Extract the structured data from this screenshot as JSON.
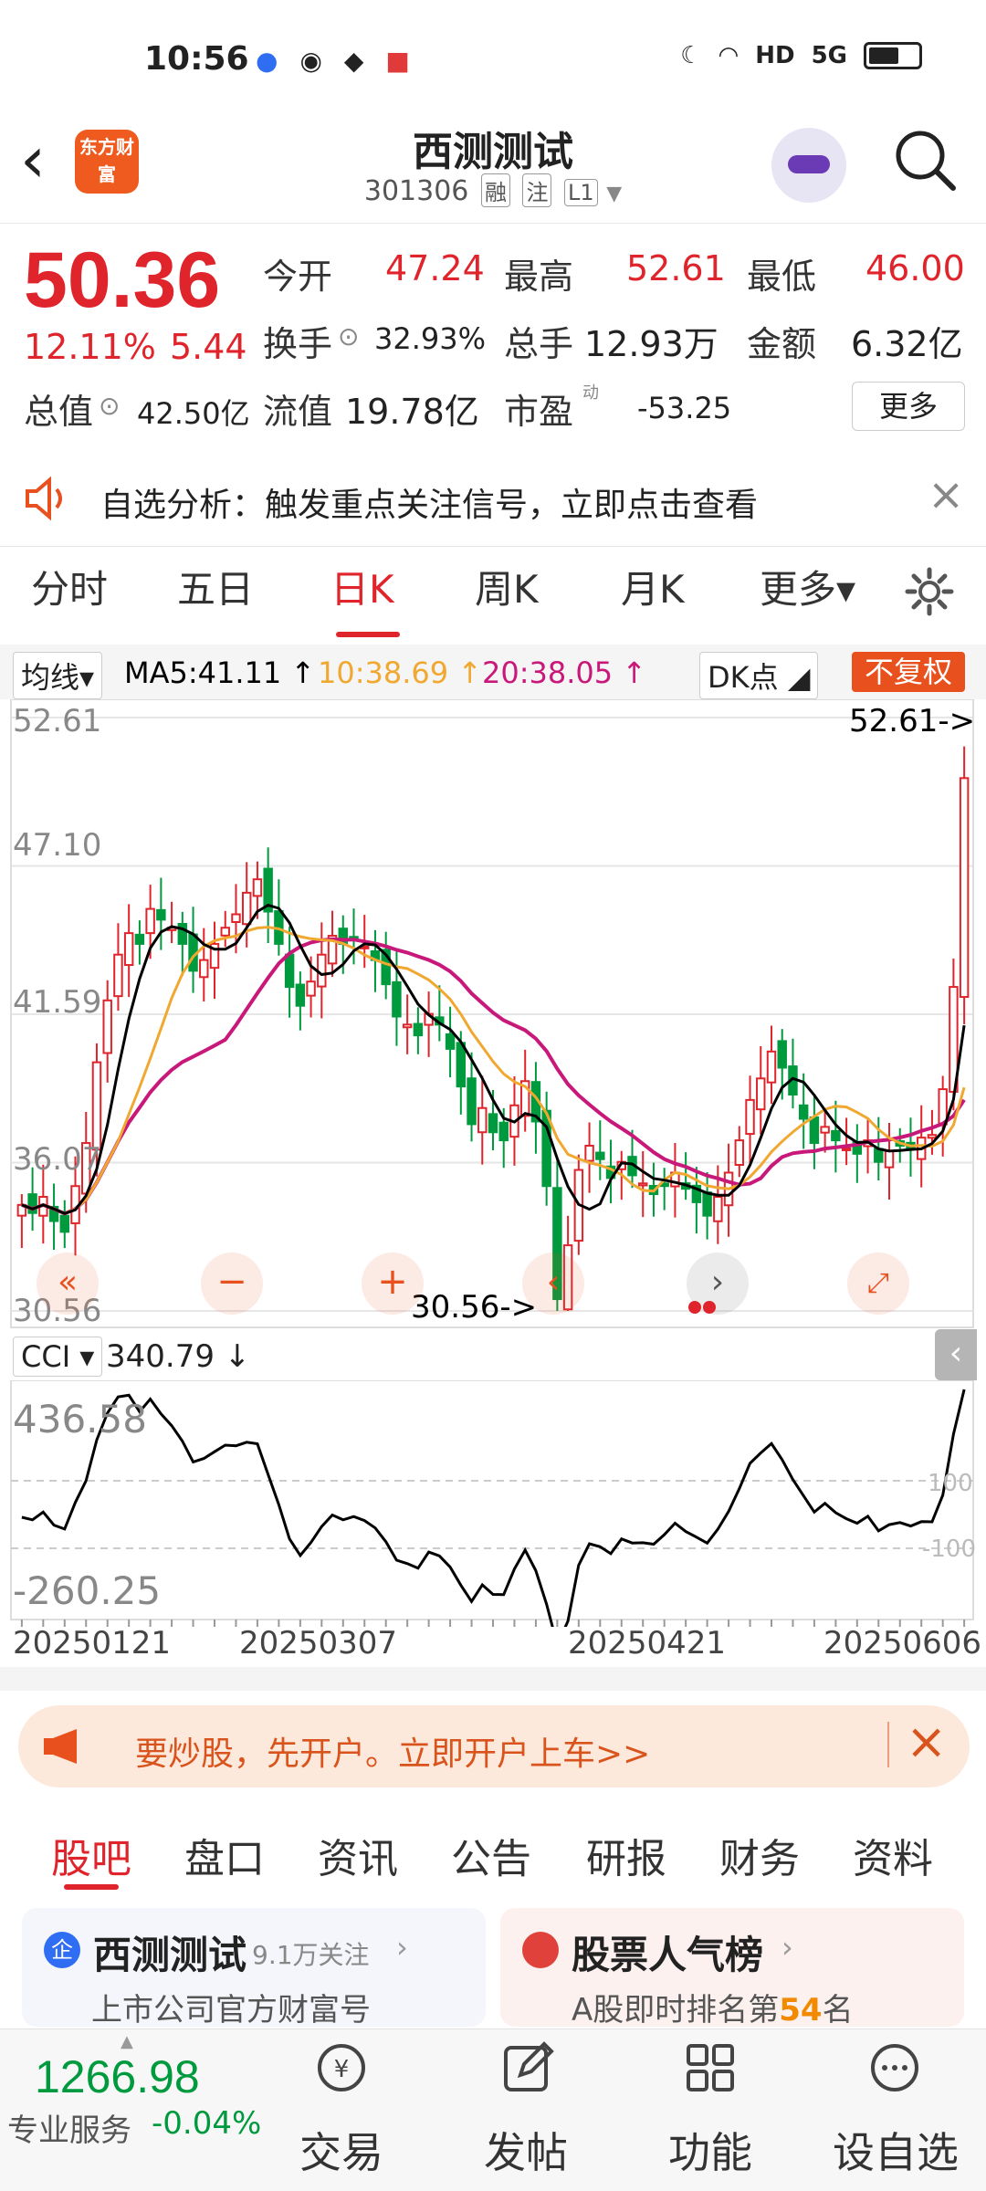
{
  "status": {
    "time": "10:56",
    "hd": "HD",
    "net": "5G"
  },
  "header": {
    "brand": "东方财富",
    "stock_name": "西测测试",
    "stock_code": "301306",
    "tags": [
      "融",
      "注",
      "L1"
    ]
  },
  "quote": {
    "price": "50.36",
    "change_pct": "12.11%",
    "change": "5.44",
    "open_label": "今开",
    "open": "47.24",
    "high_label": "最高",
    "high": "52.61",
    "low_label": "最低",
    "low": "46.00",
    "turnover_label": "换手",
    "turnover": "32.93%",
    "volume_label": "总手",
    "volume": "12.93万",
    "amount_label": "金额",
    "amount": "6.32亿",
    "mcap_label": "总值",
    "mcap": "42.50亿",
    "float_label": "流值",
    "float": "19.78亿",
    "pe_label": "市盈",
    "pe_sup": "动",
    "pe": "-53.25",
    "more": "更多"
  },
  "notice": {
    "text": "自选分析：触发重点关注信号，立即点击查看"
  },
  "tabs": [
    "分时",
    "五日",
    "日K",
    "周K",
    "月K",
    "更多▾"
  ],
  "chart_toolbar": {
    "ma_select": "均线",
    "ma5": "MA5:41.11 ↑",
    "ma10": "10:38.69 ↑",
    "ma20": "20:38.05 ↑",
    "dk": "DK点",
    "adjust": "不复权"
  },
  "chart_data": {
    "type": "candlestick",
    "y_ticks": [
      "52.61",
      "47.10",
      "41.59",
      "36.07",
      "30.56"
    ],
    "ylim": [
      30.56,
      52.61
    ],
    "max_marker": "52.61->",
    "min_marker": "30.56->",
    "close": [
      34.5,
      34.2,
      34.8,
      33.9,
      33.5,
      35.2,
      36.8,
      39.8,
      42.1,
      43.8,
      44.6,
      44.2,
      45.5,
      45.1,
      44.8,
      44.2,
      43.2,
      43.6,
      44.2,
      44.8,
      45.3,
      46.1,
      46.6,
      45.4,
      44.2,
      42.6,
      41.9,
      42.8,
      43.8,
      44.5,
      44.2,
      44.4,
      44.1,
      43.6,
      42.7,
      41.5,
      41.2,
      40.8,
      41.6,
      41.2,
      40.3,
      38.9,
      37.5,
      38.1,
      37.2,
      36.9,
      38.2,
      39.1,
      37.6,
      35.2,
      31.0,
      33.0,
      35.8,
      36.7,
      36.2,
      35.5,
      36.1,
      35.6,
      35.3,
      34.9,
      35.2,
      35.7,
      35.1,
      34.6,
      34.1,
      34.8,
      35.7,
      36.9,
      38.4,
      39.2,
      40.2,
      39.6,
      38.6,
      37.7,
      36.8,
      37.4,
      36.9,
      36.6,
      36.4,
      36.9,
      36.1,
      36.5,
      36.7,
      36.6,
      37.0,
      37.1,
      38.8,
      42.6,
      50.36
    ],
    "ma5_level": 41.11,
    "ma10_level": 38.69,
    "ma20_level": 38.05
  },
  "indicator": {
    "name": "CCI",
    "value": "340.79 ↓",
    "top": "436.58",
    "bottom": "-260.25",
    "l100": "100",
    "lm100": "-100"
  },
  "x_labels": [
    "20250121",
    "20250307",
    "20250421",
    "20250606"
  ],
  "banner": {
    "text": "要炒股，先开户。立即开户上车>>"
  },
  "bottom_tabs": [
    "股吧",
    "盘口",
    "资讯",
    "公告",
    "研报",
    "财务",
    "资料"
  ],
  "cards": {
    "left_title": "西测测试",
    "left_follow": "9.1万关注",
    "left_sub": "上市公司官方财富号",
    "right_title": "股票人气榜",
    "right_sub_a": "A股即时排名第",
    "right_rank": "54",
    "right_sub_b": "名"
  },
  "bottom_bar": {
    "index_value": "1266.98",
    "service": "专业服务",
    "index_change": "-0.04%",
    "items": [
      "交易",
      "发帖",
      "功能",
      "设自选"
    ]
  },
  "colors": {
    "up": "#e0242b",
    "down": "#009a3e",
    "ma5": "#000000",
    "ma10": "#f0a830",
    "ma20": "#c8187a",
    "accent": "#e8501e"
  }
}
